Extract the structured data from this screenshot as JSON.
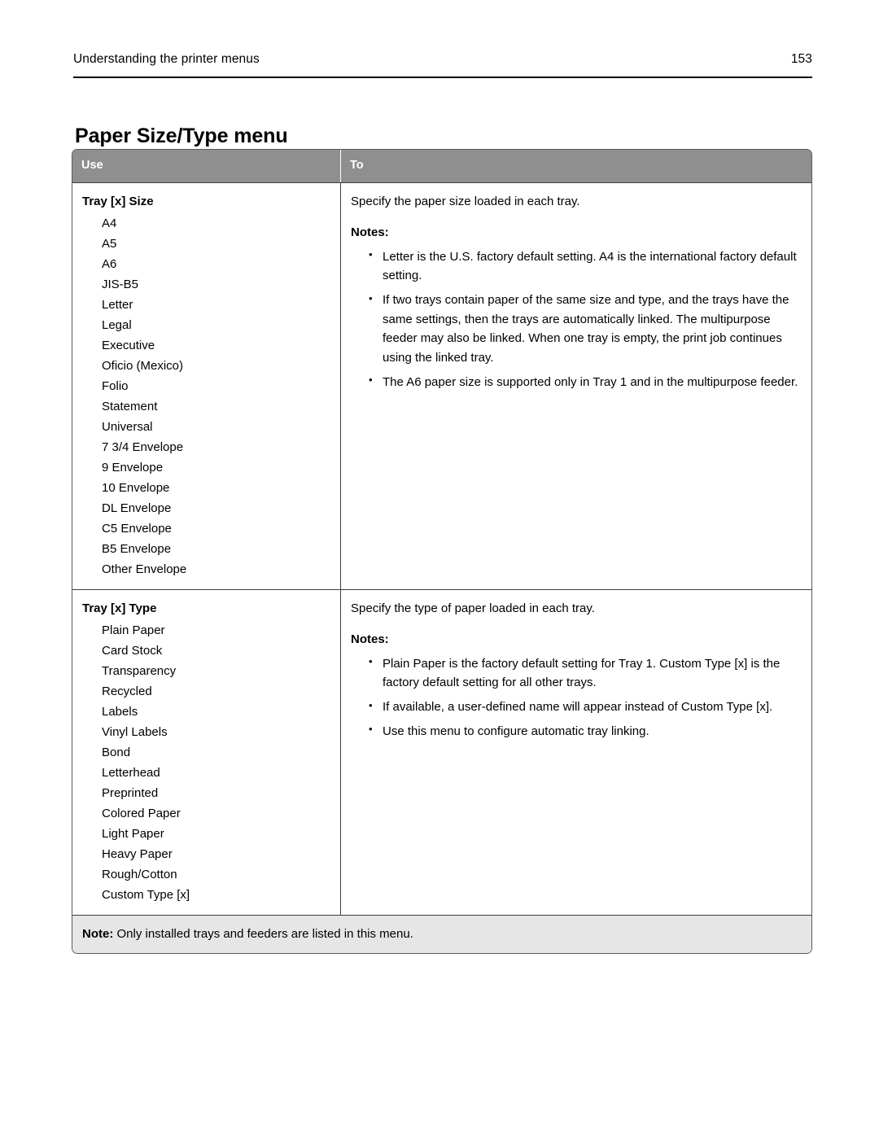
{
  "header": {
    "running_title": "Understanding the printer menus",
    "page_number": "153"
  },
  "section": {
    "title": "Paper Size/Type menu"
  },
  "table": {
    "columns": {
      "use": "Use",
      "to": "To"
    },
    "rows": [
      {
        "use_title": "Tray [x] Size",
        "use_options": [
          "A4",
          "A5",
          "A6",
          "JIS-B5",
          "Letter",
          "Legal",
          "Executive",
          "Oficio (Mexico)",
          "Folio",
          "Statement",
          "Universal",
          "7 3/4 Envelope",
          "9 Envelope",
          "10 Envelope",
          "DL Envelope",
          "C5 Envelope",
          "B5 Envelope",
          "Other Envelope"
        ],
        "description": "Specify the paper size loaded in each tray.",
        "notes_label": "Notes:",
        "notes": [
          "Letter is the U.S. factory default setting. A4 is the international factory default setting.",
          "If two trays contain paper of the same size and type, and the trays have the same settings, then the trays are automatically linked. The multipurpose feeder may also be linked. When one tray is empty, the print job continues using the linked tray.",
          "The A6 paper size is supported only in Tray 1 and in the multipurpose feeder."
        ]
      },
      {
        "use_title": "Tray [x] Type",
        "use_options": [
          "Plain Paper",
          "Card Stock",
          "Transparency",
          "Recycled",
          "Labels",
          "Vinyl Labels",
          "Bond",
          "Letterhead",
          "Preprinted",
          "Colored Paper",
          "Light Paper",
          "Heavy Paper",
          "Rough/Cotton",
          "Custom Type [x]"
        ],
        "description": "Specify the type of paper loaded in each tray.",
        "notes_label": "Notes:",
        "notes": [
          "Plain Paper is the factory default setting for Tray 1. Custom Type [x] is the factory default setting for all other trays.",
          "If available, a user-defined name will appear instead of Custom Type [x].",
          "Use this menu to configure automatic tray linking."
        ]
      }
    ],
    "footer_note_label": "Note:",
    "footer_note_text": " Only installed trays and feeders are listed in this menu.",
    "bullet_glyph": "•"
  },
  "colors": {
    "header_row_bg": "#8f8f8f",
    "footer_row_bg": "#e6e6e6",
    "border": "#3d3d3d",
    "text": "#000000"
  }
}
